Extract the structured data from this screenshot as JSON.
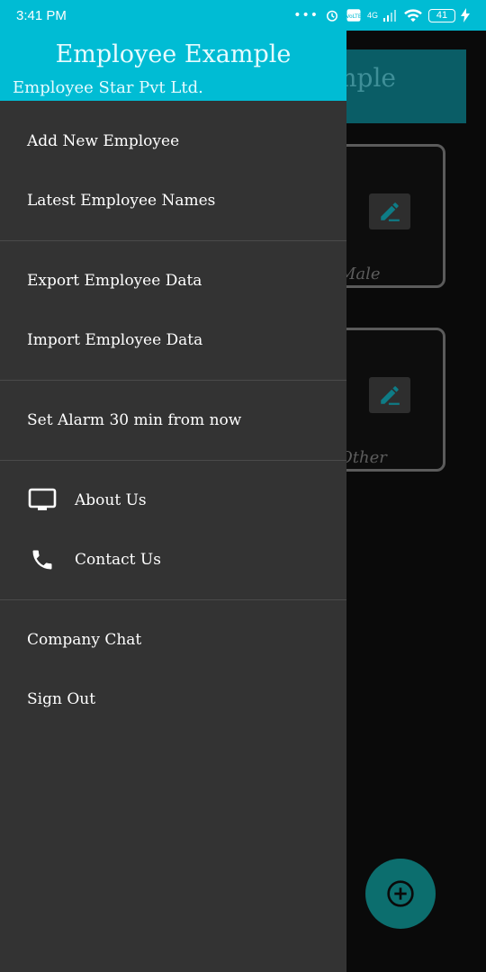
{
  "status_bar": {
    "time": "3:41 PM",
    "overflow_dots": "•••",
    "network_type": "4G",
    "battery_level": "41"
  },
  "background_app": {
    "toolbar_title_fragment": "mple",
    "cards": [
      {
        "label_fragment": "Male",
        "icon": "edit-icon"
      },
      {
        "label_fragment": "Other",
        "icon": "edit-icon"
      }
    ],
    "fab_icon": "add-circle-icon",
    "accent_color": "#0a5d66"
  },
  "drawer": {
    "title": "Employee Example",
    "subtitle": "Employee Star Pvt Ltd.",
    "header_color": "#00bcd4",
    "background_color": "#333333",
    "groups": [
      [
        {
          "label": "Add New Employee"
        },
        {
          "label": "Latest Employee Names"
        }
      ],
      [
        {
          "label": "Export Employee Data"
        },
        {
          "label": "Import Employee Data"
        }
      ],
      [
        {
          "label": "Set Alarm 30 min from now"
        }
      ],
      [
        {
          "label": "About Us",
          "icon": "monitor-icon"
        },
        {
          "label": "Contact Us",
          "icon": "phone-icon"
        }
      ],
      [
        {
          "label": "Company Chat"
        },
        {
          "label": "Sign Out"
        }
      ]
    ]
  }
}
